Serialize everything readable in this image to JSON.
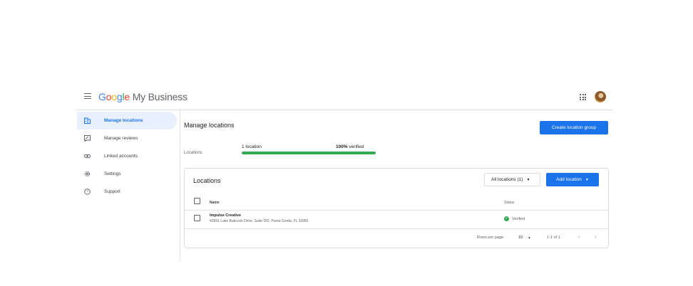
{
  "header": {
    "logo_letters": [
      "G",
      "o",
      "o",
      "g",
      "l",
      "e"
    ],
    "product_name": "My Business",
    "menu_icon": "hamburger-menu-icon",
    "apps_icon": "apps-grid-icon",
    "avatar_icon": "user-avatar"
  },
  "sidebar": {
    "items": [
      {
        "label": "Manage locations",
        "icon": "building-icon",
        "active": true
      },
      {
        "label": "Manage reviews",
        "icon": "review-icon",
        "active": false
      },
      {
        "label": "Linked accounts",
        "icon": "link-icon",
        "active": false
      },
      {
        "label": "Settings",
        "icon": "gear-icon",
        "active": false
      },
      {
        "label": "Support",
        "icon": "help-icon",
        "active": false
      }
    ]
  },
  "main": {
    "title": "Manage locations",
    "create_group_button": "Create location group",
    "summary": {
      "label": "Locations",
      "count_text": "1 location",
      "verified_pct": "100%",
      "verified_suffix": " verified",
      "progress_fraction": 1.0
    },
    "card": {
      "title": "Locations",
      "filter_value": "All locations (1)",
      "add_button": "Add location",
      "columns": {
        "name": "Name",
        "status": "Status"
      },
      "rows": [
        {
          "name": "Impulse Creative",
          "address": "42891 Lake Babcock Drive, Suite 202, Punta Gorda, FL 33982",
          "status": "Verified"
        }
      ],
      "pagination": {
        "rows_per_page_label": "Rows per page:",
        "rows_per_page_value": "10",
        "range": "1-1 of 1"
      }
    }
  },
  "colors": {
    "primary": "#1a73e8",
    "success": "#34a853",
    "active_bg": "#e8f0fe"
  }
}
